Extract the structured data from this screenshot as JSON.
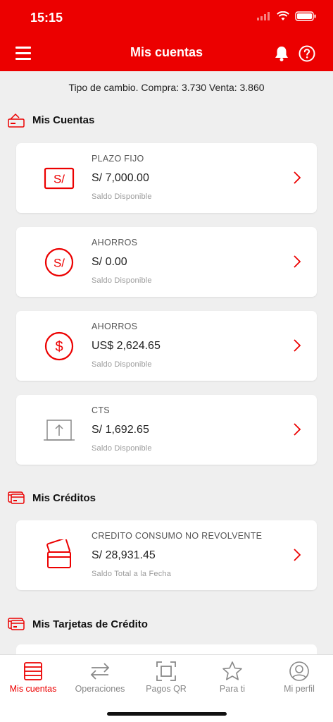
{
  "status_bar": {
    "time": "15:15"
  },
  "header": {
    "title": "Mis cuentas"
  },
  "exchange_rate": "Tipo de cambio. Compra: 3.730 Venta: 3.860",
  "sections": {
    "accounts": "Mis Cuentas",
    "credits": "Mis Créditos",
    "cards": "Mis Tarjetas de Crédito"
  },
  "accounts": [
    {
      "type": "PLAZO FIJO",
      "amount": "S/ 7,000.00",
      "sub": "Saldo Disponible",
      "icon": "soles-square-icon"
    },
    {
      "type": "AHORROS",
      "amount": "S/ 0.00",
      "sub": "Saldo Disponible",
      "icon": "soles-circle-icon"
    },
    {
      "type": "AHORROS",
      "amount": "US$ 2,624.65",
      "sub": "Saldo Disponible",
      "icon": "dollar-circle-icon"
    },
    {
      "type": "CTS",
      "amount": "S/ 1,692.65",
      "sub": "Saldo Disponible",
      "icon": "upload-box-icon"
    }
  ],
  "credits": [
    {
      "type": "CREDITO CONSUMO NO REVOLVENTE",
      "amount": "S/ 28,931.45",
      "sub": "Saldo Total a la Fecha",
      "icon": "cards-icon"
    }
  ],
  "tabs": [
    {
      "label": "Mis cuentas",
      "icon": "cards-icon",
      "active": true
    },
    {
      "label": "Operaciones",
      "icon": "transfer-arrows-icon",
      "active": false
    },
    {
      "label": "Pagos QR",
      "icon": "qr-scan-icon",
      "active": false
    },
    {
      "label": "Para ti",
      "icon": "star-icon",
      "active": false
    },
    {
      "label": "Mi perfil",
      "icon": "user-icon",
      "active": false
    }
  ],
  "colors": {
    "brand": "#ec0000",
    "background": "#efefef",
    "inactive": "#888888"
  }
}
